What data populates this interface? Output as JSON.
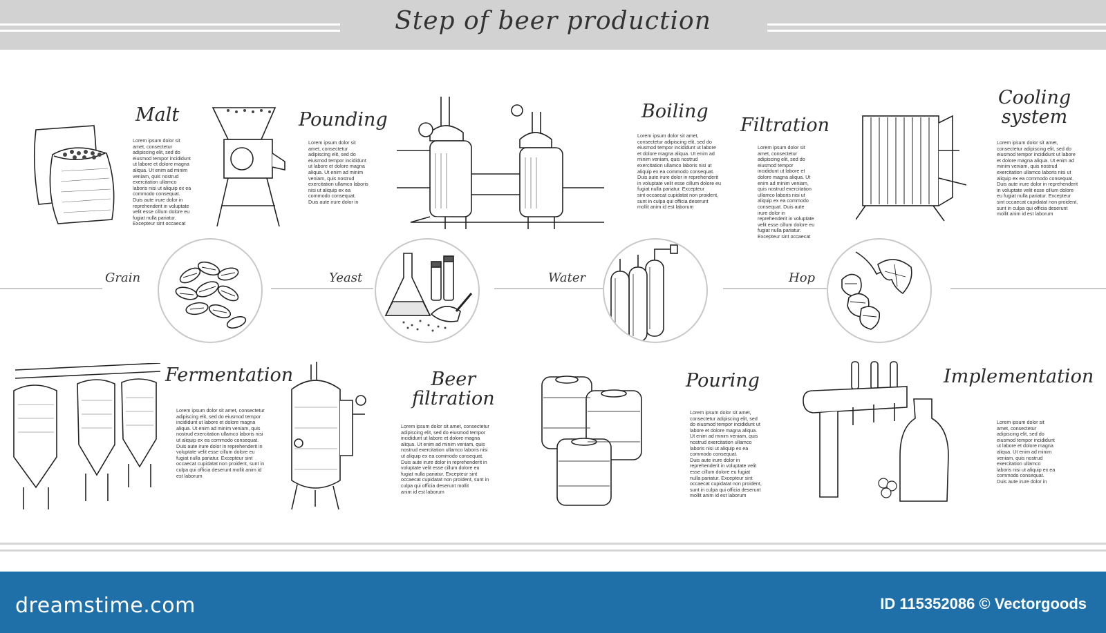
{
  "title": "Step of beer production",
  "ingredients": [
    {
      "label": "Grain",
      "icon": "grain-icon"
    },
    {
      "label": "Yeast",
      "icon": "yeast-flask-icon"
    },
    {
      "label": "Water",
      "icon": "water-cylinders-icon"
    },
    {
      "label": "Hop",
      "icon": "hop-icon"
    }
  ],
  "steps": [
    {
      "title": "Malt",
      "icon": "malt-sacks-icon",
      "text": "Lorem ipsum dolor sit\namet, consectetur\nadipiscing elit, sed do\neiusmod tempor incididunt\nut labore et dolore magna\naliqua. Ut enim ad minim\nveniam, quis nostrud\nexercitation ullamco\nlaboris nisi ut aliquip ex ea\ncommodo consequat.\nDuis aute irure dolor in\nreprehenderit in voluptate\nvelit esse cillum dolore eu\nfugiat nulla pariatur.\nExcepteur sint occaecat"
    },
    {
      "title": "Pounding",
      "icon": "grain-mill-icon",
      "text": "Lorem ipsum dolor sit\namet, consectetur\nadipiscing elit, sed do\neiusmod tempor incididunt\nut labore et dolore magna\naliqua. Ut enim ad minim\nveniam, quis nostrud\nexercitation ullamco laboris\nnisi ut aliquip ex ea\ncommodo consequat.\nDuis aute irure dolor in"
    },
    {
      "title": "Boiling",
      "icon": "brew-kettles-icon",
      "text": "Lorem ipsum dolor sit amet,\nconsectetur adipiscing elit, sed do\neiusmod tempor incididunt ut labore\net dolore magna aliqua. Ut enim ad\nminim veniam, quis nostrud\nexercitation ullamco laboris nisi ut\naliquip ex ea commodo consequat.\nDuis aute irure dolor in reprehenderit\nin voluptate velit esse cillum dolore eu\nfugiat nulla pariatur. Excepteur\nsint occaecat cupidatat non proident,\nsunt in culpa qui officia deserunt\nmollit anim id est laborum"
    },
    {
      "title": "Filtration",
      "icon": "filter-press-icon",
      "text": "Lorem ipsum dolor sit\namet, consectetur\nadipiscing elit, sed do\neiusmod tempor\nincididunt ut labore et\ndolore magna aliqua. Ut\nenim ad minim veniam,\nquis nostrud exercitation\nullamco laboris nisi ut\naliquip ex ea commodo\nconsequat. Duis aute\nirure dolor in\nreprehenderit in voluptate\nvelit esse cillum dolore eu\nfugiat nulla pariatur.\nExcepteur sint occaecat"
    },
    {
      "title": "Cooling\nsystem",
      "icon": "heat-exchanger-icon",
      "text": "Lorem ipsum dolor sit amet,\nconsectetur adipiscing elit, sed do\neiusmod tempor incididunt ut labore\net dolore magna aliqua. Ut enim ad\nminim veniam, quis nostrud\nexercitation ullamco laboris nisi ut\naliquip ex ea commodo consequat.\nDuis aute irure dolor in reprehenderit\nin voluptate velit esse cillum dolore\neu fugiat nulla pariatur. Excepteur\nsint occaecat cupidatat non proident,\nsunt in culpa qui officia deserunt\nmollit anim id est laborum"
    },
    {
      "title": "Fermentation",
      "icon": "fermentation-tanks-icon",
      "text": "Lorem ipsum dolor sit amet, consectetur\nadipiscing elit, sed do eiusmod tempor\nincididunt ut labore et dolore magna\naliqua. Ut enim ad minim veniam, quis\nnostrud exercitation ullamco laboris nisi\nut aliquip ex ea commodo consequat.\nDuis aute irure dolor in reprehenderit in\nvoluptate velit esse cillum dolore eu\nfugiat nulla pariatur. Excepteur sint\noccaecat cupidatat non proident, sunt in\nculpa qui officia deserunt mollit anim id\nest laborum"
    },
    {
      "title": "Beer\nfiltration",
      "icon": "filtration-tank-icon",
      "text": "Lorem ipsum dolor sit amet, consectetur\nadipiscing elit, sed do eiusmod tempor\nincididunt ut labore et dolore magna\naliqua. Ut enim ad minim veniam, quis\nnostrud exercitation ullamco laboris nisi\nut aliquip ex ea commodo consequat.\nDuis aute irure dolor in reprehenderit in\nvoluptate velit esse cillum dolore eu\nfugiat nulla pariatur. Excepteur sint\noccaecat cupidatat non proident, sunt in\nculpa qui officia deserunt mollit\nanim id est laborum"
    },
    {
      "title": "Pouring",
      "icon": "beer-kegs-icon",
      "text": "Lorem ipsum dolor sit amet,\nconsectetur adipiscing elit, sed\ndo eiusmod tempor incididunt ut\nlabore et dolore magna aliqua.\nUt enim ad minim veniam, quis\nnostrud exercitation ullamco\nlaboris nisi ut aliquip ex ea\ncommodo consequat.\nDuis aute irure dolor in\nreprehenderit in voluptate velit\nesse cillum dolore eu fugiat\nnulla pariatur. Excepteur sint\noccaecat cupidatat non proident,\nsunt in culpa qui officia deserunt\nmollit anim id est laborum"
    },
    {
      "title": "Implementation",
      "icon": "beer-tap-icon",
      "text": "Lorem ipsum dolor sit\namet, consectetur\nadipiscing elit, sed do\neiusmod tempor incididunt\nut labore et dolore magna\naliqua. Ut enim ad minim\nveniam, quis nostrud\nexercitation ullamco\nlaboris nisi ut aliquip ex ea\ncommodo consequat.\nDuis aute irure dolor in"
    }
  ],
  "footer": {
    "brand": "dreamstime.com",
    "credit": "ID 115352086 © Vectorgoods"
  },
  "colors": {
    "header_band": "#d2d2d2",
    "footer_band": "#1f6fa8",
    "line": "#c8c8c8",
    "ink": "#2a2a2a"
  }
}
